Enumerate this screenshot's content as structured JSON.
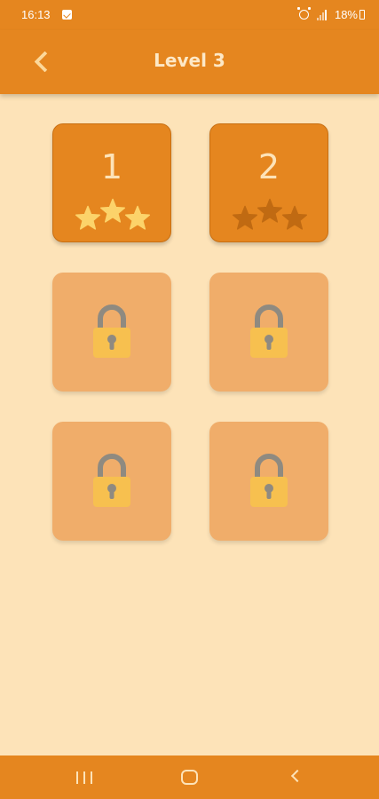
{
  "status_bar": {
    "time": "16:13",
    "battery": "18%"
  },
  "header": {
    "title": "Level 3",
    "back_icon": "chevron-left-icon"
  },
  "levels": [
    {
      "number": "1",
      "locked": false,
      "stars_earned": 3,
      "stars_total": 3
    },
    {
      "number": "2",
      "locked": false,
      "stars_earned": 0,
      "stars_total": 3
    },
    {
      "locked": true,
      "icon": "lock-icon"
    },
    {
      "locked": true,
      "icon": "lock-icon"
    },
    {
      "locked": true,
      "icon": "lock-icon"
    },
    {
      "locked": true,
      "icon": "lock-icon"
    }
  ],
  "colors": {
    "primary": "#e5861f",
    "background": "#fde3b8",
    "star_earned": "#fcd36a",
    "star_empty": "#c06a12",
    "lock_body": "#f7c04f",
    "lock_shackle": "#8f8a80",
    "locked_tile": "#f0ad6a"
  },
  "nav_bar": {
    "recents_icon": "recent-apps-icon",
    "home_icon": "home-icon",
    "back_icon": "back-icon"
  }
}
